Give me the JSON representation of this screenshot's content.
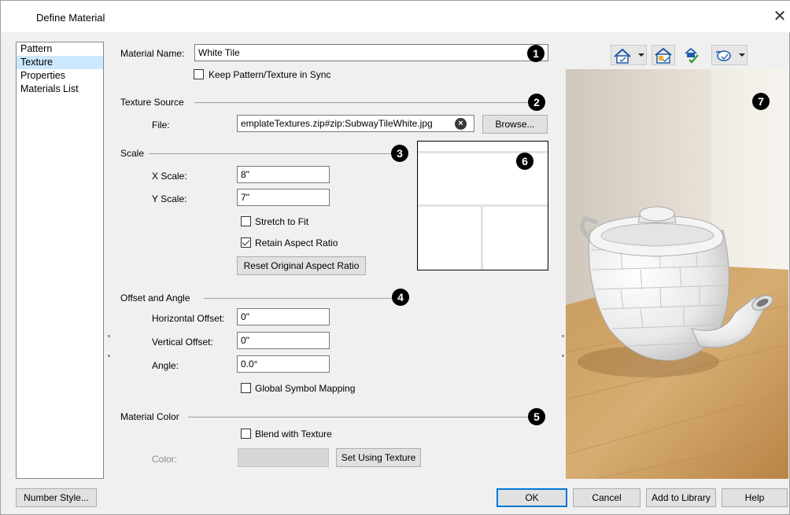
{
  "window": {
    "title": "Define Material",
    "close_glyph": "✕"
  },
  "nav": {
    "items": [
      {
        "label": "Pattern",
        "selected": false
      },
      {
        "label": "Texture",
        "selected": true
      },
      {
        "label": "Properties",
        "selected": false
      },
      {
        "label": "Materials List",
        "selected": false
      }
    ]
  },
  "material_name": {
    "label": "Material Name:",
    "value": "White Tile"
  },
  "keep_sync": {
    "label": "Keep Pattern/Texture in Sync",
    "checked": false
  },
  "texture_source": {
    "heading": "Texture Source",
    "file_label": "File:",
    "file_value": "emplateTextures.zip#zip:SubwayTileWhite.jpg",
    "browse_label": "Browse..."
  },
  "scale": {
    "heading": "Scale",
    "x_label": "X Scale:",
    "x_value": "8\"",
    "y_label": "Y Scale:",
    "y_value": "7\"",
    "stretch_label": "Stretch to Fit",
    "stretch_checked": false,
    "retain_label": "Retain Aspect Ratio",
    "retain_checked": true,
    "reset_label": "Reset Original Aspect Ratio"
  },
  "offset": {
    "heading": "Offset and Angle",
    "h_label": "Horizontal Offset:",
    "h_value": "0\"",
    "v_label": "Vertical Offset:",
    "v_value": "0\"",
    "angle_label": "Angle:",
    "angle_value": "0.0°",
    "global_label": "Global Symbol Mapping",
    "global_checked": false
  },
  "material_color": {
    "heading": "Material Color",
    "blend_label": "Blend with Texture",
    "blend_checked": false,
    "color_label": "Color:",
    "set_using_label": "Set Using Texture",
    "swatch_color": "#d6d6d6"
  },
  "callouts": [
    "1",
    "2",
    "3",
    "4",
    "5",
    "6",
    "7"
  ],
  "toolbar": {
    "icons": [
      "home-view-icon",
      "floor-view-icon",
      "material-check-icon",
      "teapot-view-icon"
    ]
  },
  "footer": {
    "number_style": "Number Style...",
    "ok": "OK",
    "cancel": "Cancel",
    "add_library": "Add to Library",
    "help": "Help"
  },
  "colors": {
    "selection": "#cce8ff",
    "accent": "#0078d7",
    "toolbar_icon": "#1e5aa8",
    "check_green": "#3a9a3a"
  }
}
